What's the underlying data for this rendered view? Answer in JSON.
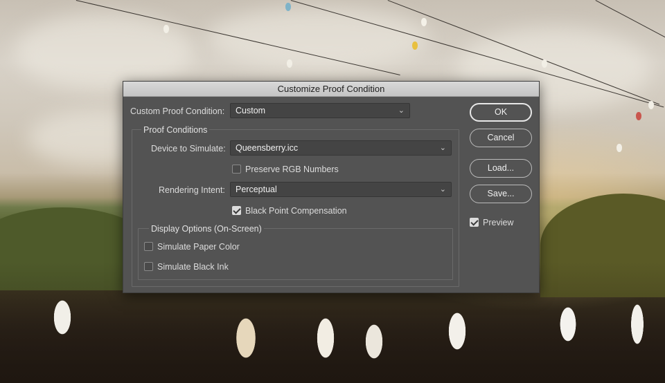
{
  "dialog": {
    "title": "Customize Proof Condition",
    "custom_proof_condition": {
      "label": "Custom Proof Condition:",
      "value": "Custom"
    },
    "proof_conditions": {
      "legend": "Proof Conditions",
      "device_to_simulate": {
        "label": "Device to Simulate:",
        "value": "Queensberry.icc"
      },
      "preserve_rgb_numbers": {
        "label": "Preserve RGB Numbers",
        "checked": false
      },
      "rendering_intent": {
        "label": "Rendering Intent:",
        "value": "Perceptual"
      },
      "black_point_compensation": {
        "label": "Black Point Compensation",
        "checked": true
      }
    },
    "display_options": {
      "legend": "Display Options (On-Screen)",
      "simulate_paper_color": {
        "label": "Simulate Paper Color",
        "checked": false
      },
      "simulate_black_ink": {
        "label": "Simulate Black Ink",
        "checked": false
      }
    },
    "buttons": {
      "ok": "OK",
      "cancel": "Cancel",
      "load": "Load...",
      "save": "Save..."
    },
    "preview": {
      "label": "Preview",
      "checked": true
    }
  },
  "icons": {
    "dropdown": "chevron-down-icon",
    "check": "checkmark-icon"
  },
  "colors": {
    "dialog_bg": "#535353",
    "titlebar_bg": "#d0d0d0",
    "field_bg": "#444444"
  }
}
